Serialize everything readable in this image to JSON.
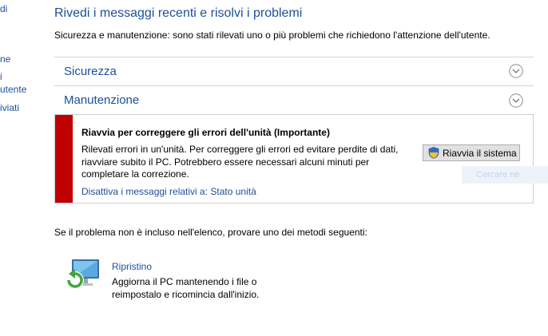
{
  "left_nav": {
    "items": [
      "di",
      "ne",
      "i",
      "utente",
      "iviati"
    ]
  },
  "header": {
    "title": "Rivedi i messaggi recenti e risolvi i problemi",
    "subtitle": "Sicurezza e manutenzione: sono stati rilevati uno o più problemi che richiedono l'attenzione dell'utente."
  },
  "sections": {
    "security_label": "Sicurezza",
    "maintenance_label": "Manutenzione"
  },
  "alert": {
    "title": "Riavvia per correggere gli errori dell'unità  (Importante)",
    "description": "Rilevati errori in un'unità. Per correggere gli errori ed evitare perdite di dati, riavviare subito il PC. Potrebbero essere necessari alcuni minuti per completare la correzione.",
    "button_label": "Riavvia il sistema",
    "link_label": "Disattiva i messaggi relativi a: Stato unità",
    "accent_color": "#c00000"
  },
  "ghost": {
    "text": "Cercare ne"
  },
  "other": {
    "text": "Se il problema non è incluso nell'elenco, provare uno dei metodi seguenti:"
  },
  "restore": {
    "link_label": "Ripristino",
    "description": "Aggiorna il PC mantenendo i file o reimpostalo e ricomincia dall'inizio."
  }
}
